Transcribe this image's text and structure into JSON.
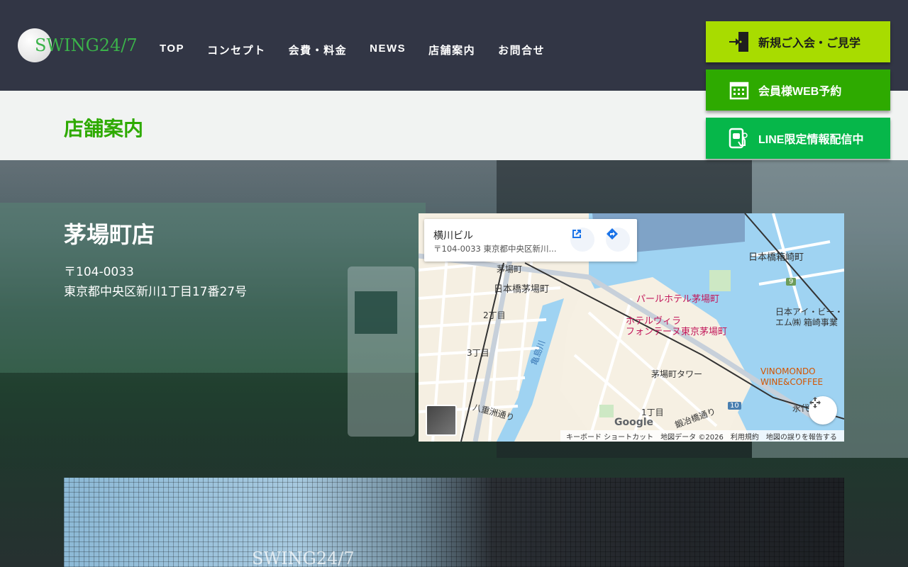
{
  "header": {
    "logo_text": "SWING24/7",
    "nav": [
      "TOP",
      "コンセプト",
      "会費・料金",
      "NEWS",
      "店舗案内",
      "お問合せ"
    ]
  },
  "cta": {
    "join": "新規ご入会・ご見学",
    "reserve": "会員様WEB予約",
    "line": "LINE限定情報配信中"
  },
  "page": {
    "title": "店舗案内"
  },
  "store": {
    "name": "茅場町店",
    "postal": "〒104-0033",
    "address": "東京都中央区新川1丁目17番27号"
  },
  "map": {
    "place_title": "横川ビル",
    "place_address": "〒104-0033 東京都中央区新川...",
    "labels": {
      "kayabacho": "茅場町",
      "nihonbashi_kayabacho": "日本橋茅場町",
      "hakozaki": "日本橋箱崎町",
      "hotel_pearl": "パールホテル茅場町",
      "hotel_villa_1": "ホテルヴィラ",
      "hotel_villa_2": "フォンテーヌ東京茅場町",
      "ibm_1": "日本アイ・ビー・",
      "ibm_2": "エム㈱ 箱崎事業",
      "tower": "茅場町タワー",
      "vinomondo_1": "VINOMONDO",
      "vinomondo_2": "WINE&COFFEE",
      "chome2": "2丁目",
      "chome3": "3丁目",
      "chome1": "1丁目",
      "kamejimagawa": "亀島川",
      "yaesu": "八重洲通り",
      "kajibashi": "鍛冶橋通り",
      "route9": "9",
      "route10": "10",
      "eitai": "永代"
    },
    "footer": {
      "shortcuts": "キーボード ショートカット",
      "mapdata": "地図データ ©2026",
      "terms": "利用規約",
      "report": "地図の誤りを報告する"
    },
    "google": "Google"
  },
  "photo": {
    "watermark": "SWING24/7"
  }
}
